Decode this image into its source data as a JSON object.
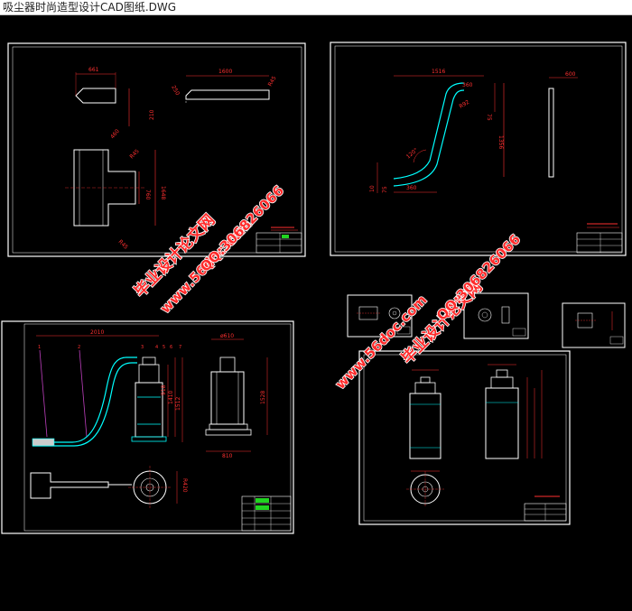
{
  "window": {
    "title": "吸尘器时尚造型设计CAD图纸.DWG"
  },
  "watermark": {
    "site_name": "毕业设计论文网",
    "url": "www.56doc.com",
    "qq": "QQ:306826066"
  },
  "sheet1": {
    "dims": [
      "661",
      "1600",
      "250",
      "210",
      "R45",
      "460",
      "760",
      "1648",
      "R45",
      "R45"
    ]
  },
  "sheet2": {
    "dims": [
      "1516",
      "360",
      "600",
      "R92",
      "75",
      "1356",
      "120°",
      "10",
      "75",
      "360"
    ]
  },
  "sheet3": {
    "dims": [
      "2010",
      "ø610",
      "1528",
      "918",
      "1410",
      "1512",
      "810",
      "R420"
    ],
    "part_numbers": [
      "1",
      "2",
      "3",
      "4",
      "5",
      "6",
      "7"
    ]
  },
  "colors": {
    "frame": "#ffffff",
    "dimension": "#ff3030",
    "body": "#ffffff",
    "accent_cyan": "#00ffff",
    "accent_green": "#21d321",
    "watermark": "#ff2a2a"
  }
}
